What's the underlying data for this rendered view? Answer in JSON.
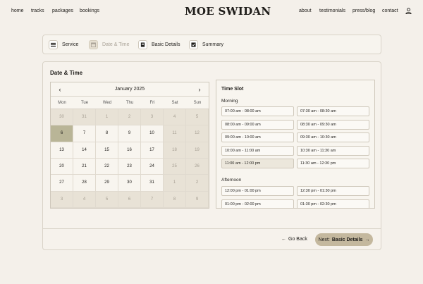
{
  "nav": {
    "left": [
      "home",
      "tracks",
      "packages",
      "bookings"
    ],
    "logo": "MOE SWIDAN",
    "right": [
      "about",
      "testimonials",
      "press/blog",
      "contact"
    ]
  },
  "steps": [
    {
      "label": "Service",
      "icon": "list-icon",
      "state": "done"
    },
    {
      "label": "Date & Time",
      "icon": "calendar-icon",
      "state": "current"
    },
    {
      "label": "Basic Details",
      "icon": "document-icon",
      "state": "todo"
    },
    {
      "label": "Summary",
      "icon": "check-icon",
      "state": "todo"
    }
  ],
  "panel_title": "Date & Time",
  "calendar": {
    "month": "January 2025",
    "dow": [
      "Mon",
      "Tue",
      "Wed",
      "Thu",
      "Fri",
      "Sat",
      "Sun"
    ],
    "days": [
      {
        "d": "30",
        "m": true
      },
      {
        "d": "31",
        "m": true
      },
      {
        "d": "1",
        "m": true
      },
      {
        "d": "2",
        "m": true
      },
      {
        "d": "3",
        "m": true
      },
      {
        "d": "4",
        "m": true
      },
      {
        "d": "5",
        "m": true
      },
      {
        "d": "6",
        "s": true
      },
      {
        "d": "7"
      },
      {
        "d": "8"
      },
      {
        "d": "9"
      },
      {
        "d": "10"
      },
      {
        "d": "11",
        "m": true
      },
      {
        "d": "12",
        "m": true
      },
      {
        "d": "13"
      },
      {
        "d": "14"
      },
      {
        "d": "15"
      },
      {
        "d": "16"
      },
      {
        "d": "17"
      },
      {
        "d": "18",
        "m": true
      },
      {
        "d": "19",
        "m": true
      },
      {
        "d": "20"
      },
      {
        "d": "21"
      },
      {
        "d": "22"
      },
      {
        "d": "23"
      },
      {
        "d": "24"
      },
      {
        "d": "25",
        "m": true
      },
      {
        "d": "26",
        "m": true
      },
      {
        "d": "27"
      },
      {
        "d": "28"
      },
      {
        "d": "29"
      },
      {
        "d": "30"
      },
      {
        "d": "31"
      },
      {
        "d": "1",
        "m": true
      },
      {
        "d": "2",
        "m": true
      },
      {
        "d": "3",
        "m": true
      },
      {
        "d": "4",
        "m": true
      },
      {
        "d": "5",
        "m": true
      },
      {
        "d": "6",
        "m": true
      },
      {
        "d": "7",
        "m": true
      },
      {
        "d": "8",
        "m": true
      },
      {
        "d": "9",
        "m": true
      }
    ]
  },
  "timeslot": {
    "title": "Time Slot",
    "morning_label": "Morning",
    "morning": [
      "07:00 am - 08:00 am",
      "07:30 am - 08:30 am",
      "08:00 am - 09:00 am",
      "08:30 am - 09:30 am",
      "09:00 am - 10:00 am",
      "09:30 am - 10:30 am",
      "10:00 am - 11:00 am",
      "10:30 am - 11:30 am",
      "11:00 am - 12:00 pm",
      "11:30 am - 12:30 pm"
    ],
    "morning_selected": 8,
    "afternoon_label": "Afternoon",
    "afternoon": [
      "12:00 pm - 01:00 pm",
      "12:30 pm - 01:30 pm",
      "01:00 pm - 02:00 pm",
      "01:30 pm - 02:30 pm"
    ]
  },
  "back_label": "Go Back",
  "next_prefix": "Next:",
  "next_label": "Basic Details",
  "colors": {
    "background": "#f4f0ea",
    "selected_day": "#b9b597",
    "next_button": "#c4b89e"
  }
}
